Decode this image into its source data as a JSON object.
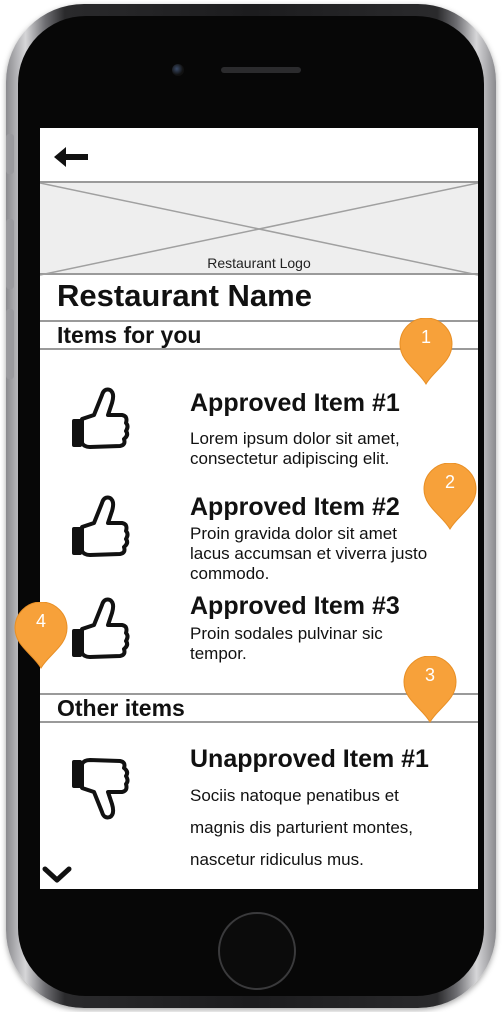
{
  "screen": {
    "logo_label": "Restaurant Logo",
    "restaurant_name": "Restaurant Name",
    "sections": {
      "approved_heading": "Items for you",
      "other_heading": "Other items"
    },
    "approved_items": [
      {
        "title": "Approved Item #1",
        "description": "Lorem ipsum dolor sit amet, consectetur adipiscing elit."
      },
      {
        "title": "Approved Item #2",
        "description": "Proin gravida dolor sit amet lacus accumsan et viverra justo commodo."
      },
      {
        "title": "Approved Item #3",
        "description": "Proin sodales pulvinar sic tempor."
      }
    ],
    "other_items": [
      {
        "title": "Unapproved Item #1",
        "description": "Sociis natoque penatibus et magnis dis parturient montes, nascetur ridiculus mus."
      }
    ]
  },
  "annotations": [
    "1",
    "2",
    "3",
    "4"
  ],
  "colors": {
    "marker": "#f7a13a",
    "divider": "#9a9a9a",
    "logo_placeholder": "#eeeeee",
    "phone_body": "#1c1c1e"
  },
  "icons": [
    "back-arrow-icon",
    "thumbs-up-icon",
    "thumbs-down-icon",
    "chevron-down-icon"
  ]
}
